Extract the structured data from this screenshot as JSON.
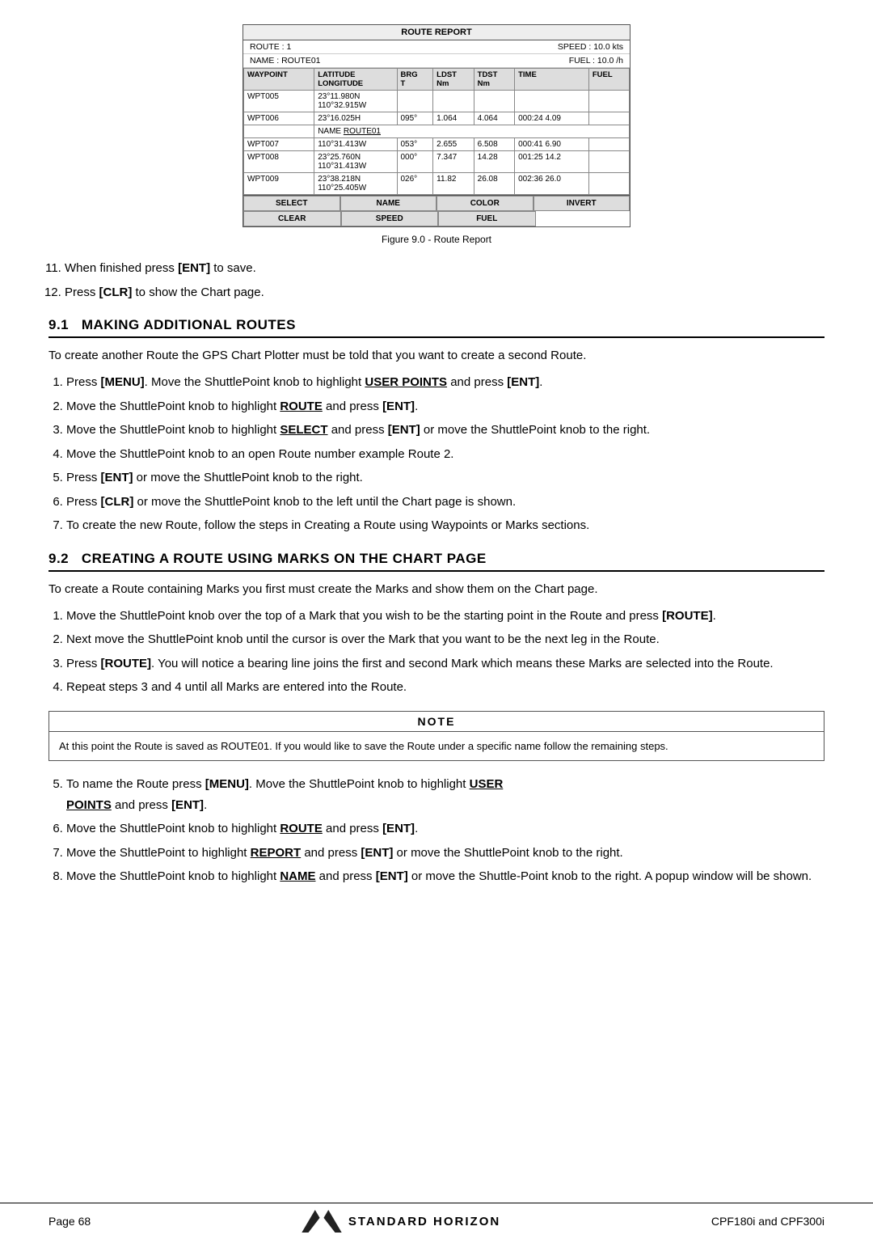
{
  "routeReport": {
    "title": "ROUTE REPORT",
    "route": "ROUTE : 1",
    "speed": "SPEED : 10.0 kts",
    "name": "NAME : ROUTE01",
    "fuel": "FUEL : 10.0 /h",
    "tableHeaders": [
      "WAYPOINT",
      "LATITUDE\nLONGITUDE",
      "BRG\nT",
      "LDST\nNm",
      "TDST\nNm",
      "TIME",
      "FUEL"
    ],
    "rows": [
      [
        "WPT005",
        "23°11.980N\n110°32.915W",
        "",
        "",
        "",
        "",
        ""
      ],
      [
        "WPT006",
        "23°16.025H",
        "095°",
        "1.064",
        "4.064",
        "000:24 4.09",
        ""
      ],
      [
        "",
        "NAME  ROUTE01",
        "",
        "",
        "",
        "",
        ""
      ],
      [
        "WPT007",
        "110°31.413W",
        "053°",
        "2.655",
        "6.508",
        "000:41 6.90",
        ""
      ],
      [
        "WPT008",
        "23°25.760N\n110°31.413W",
        "000°",
        "7.347",
        "14.28",
        "001:25 14.2",
        ""
      ],
      [
        "WPT009",
        "23°38.218N\n110°25.405W",
        "026°",
        "11.82",
        "26.08",
        "002:36 26.0",
        ""
      ]
    ],
    "buttons": {
      "row1": [
        "SELECT",
        "NAME",
        "COLOR",
        "INVERT"
      ],
      "row2": [
        "CLEAR",
        "SPEED",
        "FUEL",
        ""
      ]
    },
    "caption": "Figure 9.0 -  Route Report"
  },
  "steps1": [
    "When finished press [ENT] to save.",
    "Press [CLR] to show the Chart page."
  ],
  "section91": {
    "number": "9.1",
    "title": "MAKING ADDITIONAL ROUTES",
    "intro": "To create another Route the GPS Chart Plotter must be told that you want to create a second Route.",
    "steps": [
      "Press [MENU]. Move the ShuttlePoint knob to highlight USER POINTS and press [ENT].",
      "Move the ShuttlePoint knob to highlight ROUTE and press [ENT].",
      "Move the ShuttlePoint knob to highlight SELECT and press [ENT] or move the ShuttlePoint knob to the right.",
      "Move the ShuttlePoint knob to an open Route number example Route 2.",
      "Press [ENT] or move the ShuttlePoint knob to the right.",
      "Press [CLR] or move the ShuttlePoint knob to the left until the Chart page is shown.",
      "To create the new Route, follow the steps in Creating a Route using Waypoints or Marks sections."
    ]
  },
  "section92": {
    "number": "9.2",
    "title": "CREATING A ROUTE USING MARKS ON THE CHART PAGE",
    "intro": "To create a Route containing Marks you first must create the Marks and show them on the Chart page.",
    "steps": [
      "Move the ShuttlePoint knob over the top of a Mark that you wish to be the starting point in the Route and press [ROUTE].",
      "Next move the ShuttlePoint knob until the cursor is over the Mark that you want to be the next leg in the Route.",
      "Press [ROUTE]. You will notice a bearing line joins the first and second Mark which means these Marks are selected into the Route.",
      "Repeat steps 3 and 4 until all Marks are entered into the Route."
    ],
    "note": {
      "title": "NOTE",
      "content": "At this point the Route is saved as ROUTE01. If you would like to save the Route under a specific name follow the remaining steps."
    },
    "steps2": [
      "To name the Route press [MENU]. Move the ShuttlePoint knob to highlight USER POINTS and press [ENT].",
      "Move the ShuttlePoint knob to highlight ROUTE and press [ENT].",
      "Move the ShuttlePoint to highlight REPORT and press [ENT] or move the ShuttlePoint knob to the right.",
      "Move the ShuttlePoint knob to highlight NAME and press [ENT] or move the ShuttlePoint knob to the right. A popup window will be shown."
    ]
  },
  "footer": {
    "page": "Page  68",
    "brand": "STANDARD HORIZON",
    "model": "CPF180i and CPF300i"
  }
}
